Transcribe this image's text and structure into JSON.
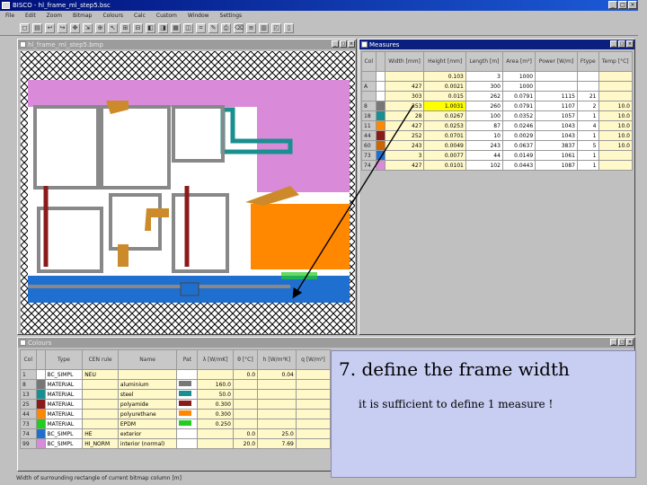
{
  "app": {
    "title": "BISCO - hl_frame_ml_step5.bsc"
  },
  "window_controls": {
    "minimize": "_",
    "maximize": "□",
    "close": "×"
  },
  "menu": [
    "File",
    "Edit",
    "Zoom",
    "Bitmap",
    "Colours",
    "Calc",
    "Custom",
    "Window",
    "Settings"
  ],
  "toolbar": [
    "◻",
    "▤",
    "↩",
    "↪",
    "✥",
    "⇲",
    "⊕",
    "↖",
    "⊞",
    "⊟",
    "◧",
    "◨",
    "▦",
    "◫",
    "⌗",
    "✎",
    "⎙",
    "⌫",
    "≡",
    "▥",
    "◰",
    "▯"
  ],
  "drawing": {
    "title": "hl_frame_ml_step5.bmp"
  },
  "measures": {
    "title": "Measures",
    "headers": [
      "Col",
      "",
      "Width [mm]",
      "Height [mm]",
      "Length [m]",
      "Area [m²]",
      "Power [W/m]",
      "Ftype",
      "Temp [°C]"
    ],
    "rows": [
      {
        "id": "",
        "width": "",
        "height": "0.103",
        "length": "3",
        "area": "1000",
        "power": "",
        "ftype": "",
        "temp": "",
        "color": "#ffffff"
      },
      {
        "id": "A",
        "width": "427",
        "height": "0.0021",
        "length": "300",
        "area": "1000",
        "power": "",
        "ftype": "",
        "temp": "",
        "color": "#ffffff"
      },
      {
        "id": "",
        "width": "303",
        "height": "0.015",
        "length": "262",
        "area": "0.0791",
        "power": "1115",
        "ftype": "21",
        "temp": "",
        "color": "#ffffff"
      },
      {
        "id": "8",
        "width": "353",
        "height": "1.0031",
        "length": "260",
        "area": "0.0791",
        "power": "1107",
        "ftype": "2",
        "temp": "10.0",
        "color": "#777777"
      },
      {
        "id": "18",
        "width": "28",
        "height": "0.0267",
        "length": "100",
        "area": "0.0352",
        "power": "1057",
        "ftype": "1",
        "temp": "10.0",
        "color": "#1a8f8f"
      },
      {
        "id": "11",
        "width": "427",
        "height": "0.0253",
        "length": "87",
        "area": "0.0246",
        "power": "1043",
        "ftype": "4",
        "temp": "10.0",
        "color": "#ff8800"
      },
      {
        "id": "44",
        "width": "252",
        "height": "0.0701",
        "length": "10",
        "area": "0.0029",
        "power": "1043",
        "ftype": "1",
        "temp": "10.0",
        "color": "#8b1a1a"
      },
      {
        "id": "60",
        "width": "243",
        "height": "0.0049",
        "length": "243",
        "area": "0.0637",
        "power": "3837",
        "ftype": "5",
        "temp": "10.0",
        "color": "#cc6600"
      },
      {
        "id": "73",
        "width": "3",
        "height": "0.0077",
        "length": "44",
        "area": "0.0149",
        "power": "1061",
        "ftype": "1",
        "temp": "",
        "color": "#1f6fd0"
      },
      {
        "id": "74",
        "width": "427",
        "height": "0.0101",
        "length": "102",
        "area": "0.0443",
        "power": "1087",
        "ftype": "1",
        "temp": "",
        "color": "#d98ad9"
      }
    ]
  },
  "colours": {
    "title": "Colours",
    "headers": [
      "Col",
      "",
      "Type",
      "CEN rule",
      "Name",
      "Pat",
      "λ [W/mK]",
      "θ [°C]",
      "h [W/m²K]",
      "q [W/m²]"
    ],
    "rows": [
      {
        "col": "1",
        "type": "BC_SIMPL",
        "cen": "NEU",
        "name": "",
        "lambda": "",
        "theta": "0.0",
        "h": "0.04",
        "q": "",
        "color": "#ffffff"
      },
      {
        "col": "8",
        "type": "MATERIAL",
        "cen": "",
        "name": "aluminium",
        "lambda": "160.0",
        "theta": "",
        "h": "",
        "q": "",
        "color": "#777777"
      },
      {
        "col": "13",
        "type": "MATERIAL",
        "cen": "",
        "name": "steel",
        "lambda": "50.0",
        "theta": "",
        "h": "",
        "q": "",
        "color": "#1a8f8f"
      },
      {
        "col": "25",
        "type": "MATERIAL",
        "cen": "",
        "name": "polyamide",
        "lambda": "0.300",
        "theta": "",
        "h": "",
        "q": "",
        "color": "#8b1a1a"
      },
      {
        "col": "44",
        "type": "MATERIAL",
        "cen": "",
        "name": "polyurethane",
        "lambda": "0.300",
        "theta": "",
        "h": "",
        "q": "",
        "color": "#ff8800"
      },
      {
        "col": "73",
        "type": "MATERIAL",
        "cen": "",
        "name": "EPDM",
        "lambda": "0.250",
        "theta": "",
        "h": "",
        "q": "",
        "color": "#22cc22"
      },
      {
        "col": "74",
        "type": "BC_SIMPL",
        "cen": "HE",
        "name": "exterior",
        "lambda": "",
        "theta": "0.0",
        "h": "25.0",
        "q": "",
        "color": "#1f6fd0"
      },
      {
        "col": "99",
        "type": "BC_SIMPL",
        "cen": "HI_NORM",
        "name": "interior (normal)",
        "lambda": "",
        "theta": "20.0",
        "h": "7.69",
        "q": "",
        "color": "#d98ad9"
      }
    ]
  },
  "status": "Width of surrounding rectangle of current bitmap column [m]",
  "tutorial": {
    "heading": "7. define the frame width",
    "note": "it is sufficient to define 1 measure !"
  }
}
